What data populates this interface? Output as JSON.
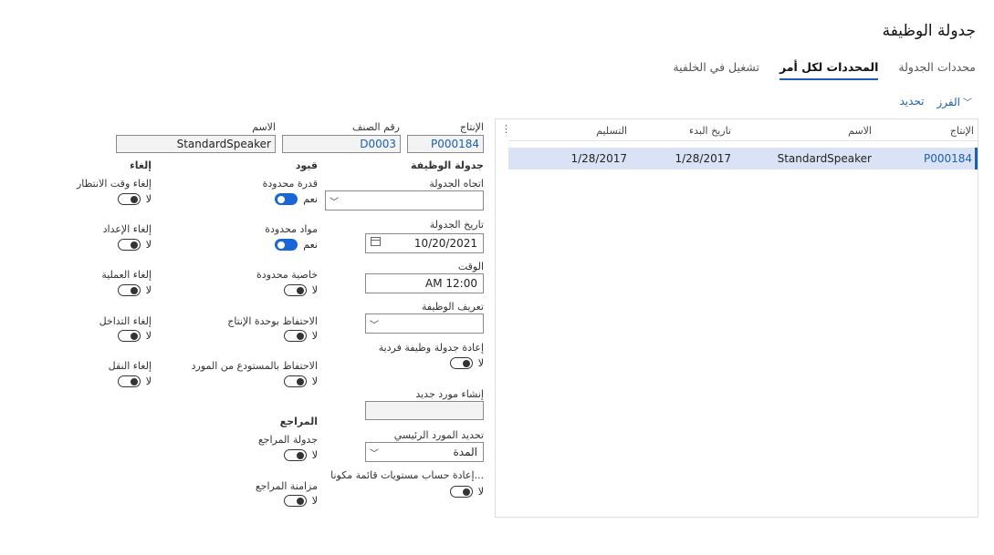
{
  "page_title": "جدولة الوظيفة",
  "tabs": [
    "محددات الجدولة",
    "المحددات لكل أمر",
    "تشغيل في الخلفية"
  ],
  "actions": {
    "sort": "الفرز",
    "select": "تحديد"
  },
  "grid": {
    "columns": [
      "الإنتاج",
      "الاسم",
      "تاريخ البدء",
      "التسليم"
    ],
    "rows": [
      {
        "production": "P000184",
        "name": "StandardSpeaker",
        "start": "1/28/2017",
        "delivery": "1/28/2017"
      }
    ]
  },
  "detail": {
    "production_label": "الإنتاج",
    "production_value": "P000184",
    "item_label": "رقم الصنف",
    "item_value": "D0003",
    "name_label": "الاسم",
    "name_value": "StandardSpeaker"
  },
  "job_schedule": {
    "header": "جدولة الوظيفة",
    "direction_label": "اتجاه الجدولة",
    "direction_value": "",
    "date_label": "تاريخ الجدولة",
    "date_value": "10/20/2021",
    "time_label": "الوقت",
    "time_value": "AM 12:00",
    "job_def_label": "تعريف الوظيفة",
    "job_def_value": "",
    "reschedule_label": "إعادة جدولة وظيفة فردية",
    "reschedule_value": "لا",
    "new_vendor_label": "إنشاء مورد جديد",
    "new_vendor_value": "",
    "primary_vendor_label": "تحديد المورد الرئيسي",
    "primary_vendor_value": "المدة",
    "recalc_label": "إعادة حساب مستويات قائمة مكونا...",
    "recalc_value": "لا"
  },
  "constraints": {
    "header": "قيود",
    "items": [
      {
        "label": "قدرة محدودة",
        "value": "نعم",
        "on": true
      },
      {
        "label": "مواد محدودة",
        "value": "نعم",
        "on": true
      },
      {
        "label": "خاصية محدودة",
        "value": "لا",
        "on": false
      },
      {
        "label": "الاحتفاظ بوحدة الإنتاج",
        "value": "لا",
        "on": false
      },
      {
        "label": "الاحتفاظ بالمستودع من المورد",
        "value": "لا",
        "on": false
      }
    ]
  },
  "references": {
    "header": "المراجع",
    "items": [
      {
        "label": "جدولة المراجع",
        "value": "لا",
        "on": false
      },
      {
        "label": "مزامنة المراجع",
        "value": "لا",
        "on": false
      }
    ]
  },
  "cancel": {
    "header": "إلغاء",
    "items": [
      {
        "label": "إلغاء وقت الانتظار",
        "value": "لا",
        "on": false
      },
      {
        "label": "إلغاء الإعداد",
        "value": "لا",
        "on": false
      },
      {
        "label": "إلغاء العملية",
        "value": "لا",
        "on": false
      },
      {
        "label": "إلغاء التداخل",
        "value": "لا",
        "on": false
      },
      {
        "label": "إلغاء النقل",
        "value": "لا",
        "on": false
      }
    ]
  }
}
